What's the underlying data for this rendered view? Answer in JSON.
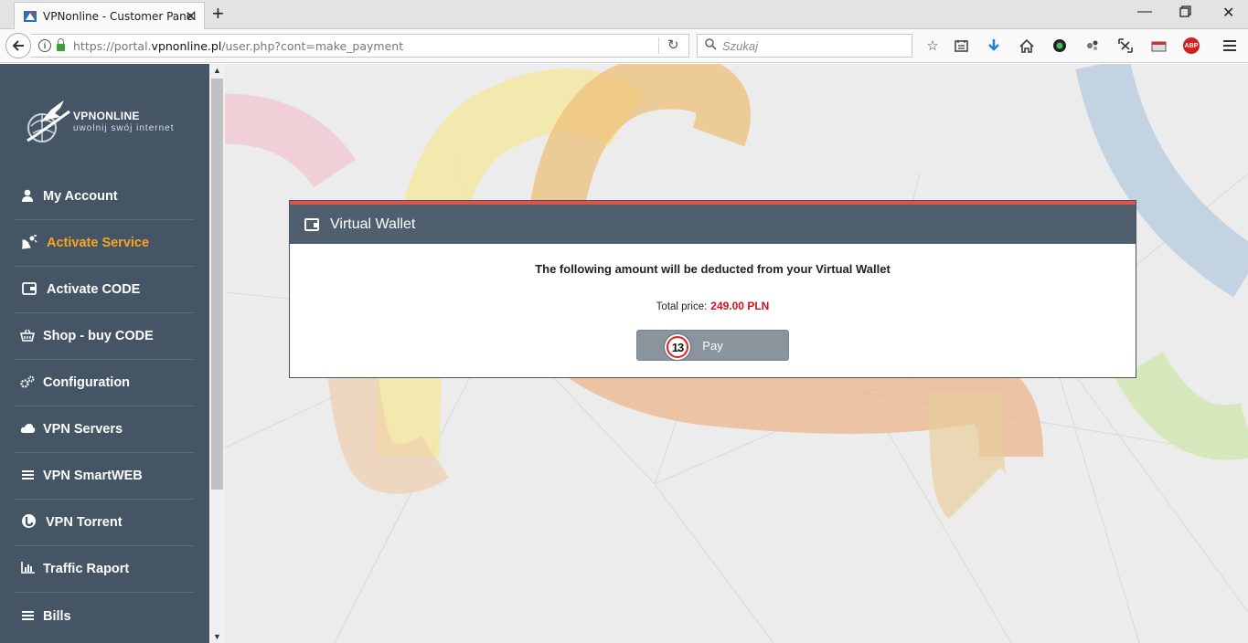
{
  "browser": {
    "tab_title": "VPNonline - Customer Panel",
    "url_prefix": "https://portal.",
    "url_domain": "vpnonline.pl",
    "url_path": "/user.php?cont=make_payment",
    "search_placeholder": "Szukaj"
  },
  "sidebar": {
    "logo_name": "VPNONLINE",
    "logo_tagline": "uwolnij swój internet",
    "items": [
      {
        "label": "My Account",
        "icon": "user-icon",
        "active": false
      },
      {
        "label": "Activate Service",
        "icon": "satellite-icon",
        "active": true
      },
      {
        "label": "Activate CODE",
        "icon": "wallet-icon",
        "active": false
      },
      {
        "label": "Shop - buy CODE",
        "icon": "basket-icon",
        "active": false
      },
      {
        "label": "Configuration",
        "icon": "gears-icon",
        "active": false
      },
      {
        "label": "VPN Servers",
        "icon": "cloud-icon",
        "active": false
      },
      {
        "label": "VPN SmartWEB",
        "icon": "list-icon",
        "active": false
      },
      {
        "label": "VPN Torrent",
        "icon": "torrent-icon",
        "active": false
      },
      {
        "label": "Traffic Raport",
        "icon": "bar-chart-icon",
        "active": false
      },
      {
        "label": "Bills",
        "icon": "list-icon",
        "active": false
      }
    ]
  },
  "panel": {
    "title": "Virtual Wallet",
    "message": "The following amount will be deducted from your Virtual Wallet",
    "price_label": "Total price:",
    "price_value": "249.00 PLN",
    "pay_label": "Pay",
    "step_number": "13"
  },
  "colors": {
    "sidebar_bg": "#455565",
    "active_item": "#f5a623",
    "panel_header": "#505f6e",
    "panel_accent": "#e0534a",
    "price": "#d0101b"
  }
}
